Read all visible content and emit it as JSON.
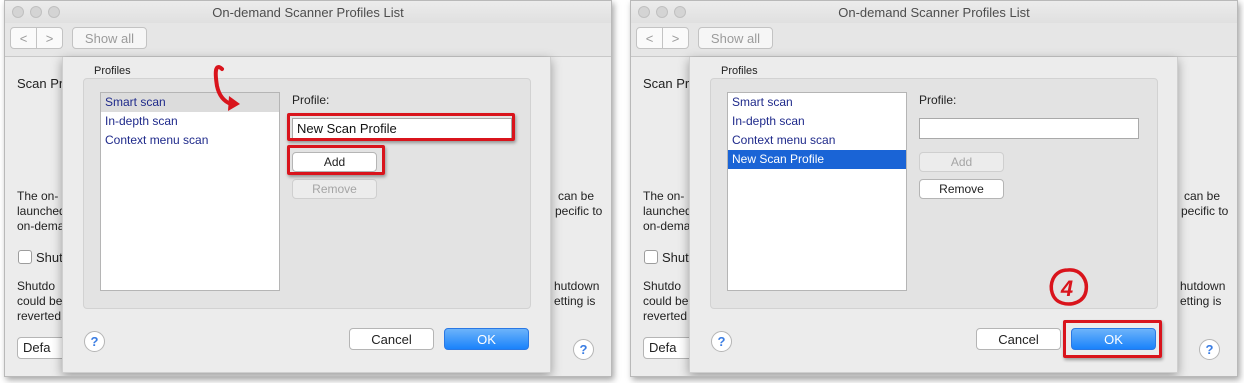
{
  "panels": [
    {
      "window": {
        "title": "On-demand Scanner Profiles List",
        "nav_back": "<",
        "nav_forward": ">",
        "show_all": "Show all"
      },
      "background": {
        "scan_label": "Scan Pr",
        "desc_left": [
          "The on-",
          "launched",
          "on-dema"
        ],
        "desc_right": [
          "can be",
          "pecific to"
        ],
        "checkbox_label": "Shut",
        "shutdown_left": [
          "Shutdo",
          "could be",
          "reverted"
        ],
        "shutdown_right": [
          "hutdown",
          "etting is"
        ],
        "default_button": "Defa",
        "help": "?"
      },
      "sheet": {
        "group_title": "Profiles",
        "profiles": [
          "Smart scan",
          "In-depth scan",
          "Context menu scan"
        ],
        "selected_index": 0,
        "profile_label": "Profile:",
        "profile_value": "New Scan Profile",
        "add_label": "Add",
        "remove_label": "Remove",
        "cancel_label": "Cancel",
        "ok_label": "OK",
        "help": "?"
      }
    },
    {
      "window": {
        "title": "On-demand Scanner Profiles List",
        "nav_back": "<",
        "nav_forward": ">",
        "show_all": "Show all"
      },
      "background": {
        "scan_label": "Scan Pr",
        "desc_left": [
          "The on-",
          "launched",
          "on-dema"
        ],
        "desc_right": [
          "can be",
          "pecific to"
        ],
        "checkbox_label": "Shut",
        "shutdown_left": [
          "Shutdo",
          "could be",
          "reverted"
        ],
        "shutdown_right": [
          "hutdown",
          "etting is"
        ],
        "default_button": "Defa",
        "help": "?"
      },
      "sheet": {
        "group_title": "Profiles",
        "profiles": [
          "Smart scan",
          "In-depth scan",
          "Context menu scan",
          "New Scan Profile"
        ],
        "selected_index": 3,
        "profile_label": "Profile:",
        "profile_value": "",
        "add_label": "Add",
        "remove_label": "Remove",
        "cancel_label": "Cancel",
        "ok_label": "OK",
        "help": "?"
      }
    }
  ],
  "annotation": {
    "step_number": "4",
    "highlight_color": "#d9141c"
  },
  "colors": {
    "ok_button": "#1a82fb",
    "selection": "#1a64d6",
    "list_text": "#1f2a8b"
  }
}
